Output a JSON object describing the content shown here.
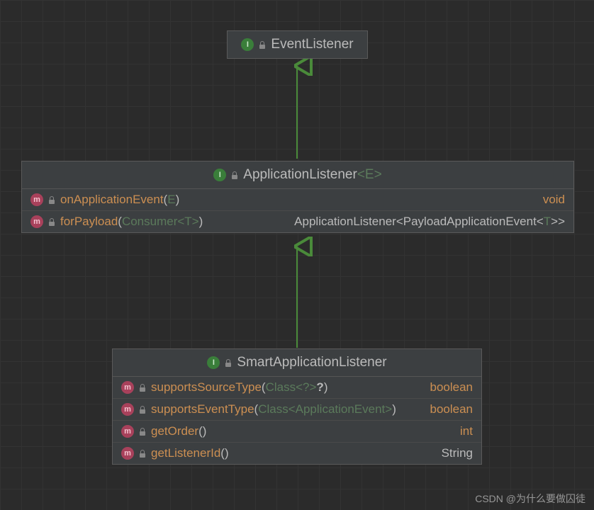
{
  "watermark": "CSDN @为什么要做囚徒",
  "nodes": {
    "eventListener": {
      "title": "EventListener"
    },
    "applicationListener": {
      "title": "ApplicationListener",
      "typeParam": "<E>",
      "methods": [
        {
          "name": "onApplicationEvent",
          "paramsPrefix": "(",
          "params": "E",
          "paramsSuffix": ")",
          "ret": "void",
          "retPrimitive": true
        },
        {
          "name": "forPayload",
          "paramsPrefix": "(",
          "params": "Consumer<T>",
          "paramsSuffix": ")",
          "ret": "ApplicationListener<PayloadApplicationEvent<T>>",
          "retPrimitive": false
        }
      ]
    },
    "smartApplicationListener": {
      "title": "SmartApplicationListener",
      "methods": [
        {
          "name": "supportsSourceType",
          "paramsPrefix": "(",
          "params": "Class<?>",
          "paramsBold": "?",
          "paramsSuffix": ")",
          "ret": "boolean",
          "retPrimitive": true
        },
        {
          "name": "supportsEventType",
          "paramsPrefix": "(",
          "params": "Class<ApplicationEvent>",
          "paramsSuffix": ")",
          "ret": "boolean",
          "retPrimitive": true
        },
        {
          "name": "getOrder",
          "paramsPrefix": "(",
          "params": "",
          "paramsSuffix": ")",
          "ret": "int",
          "retPrimitive": true
        },
        {
          "name": "getListenerId",
          "paramsPrefix": "(",
          "params": "",
          "paramsSuffix": ")",
          "ret": "String",
          "retPrimitive": false
        }
      ]
    }
  }
}
